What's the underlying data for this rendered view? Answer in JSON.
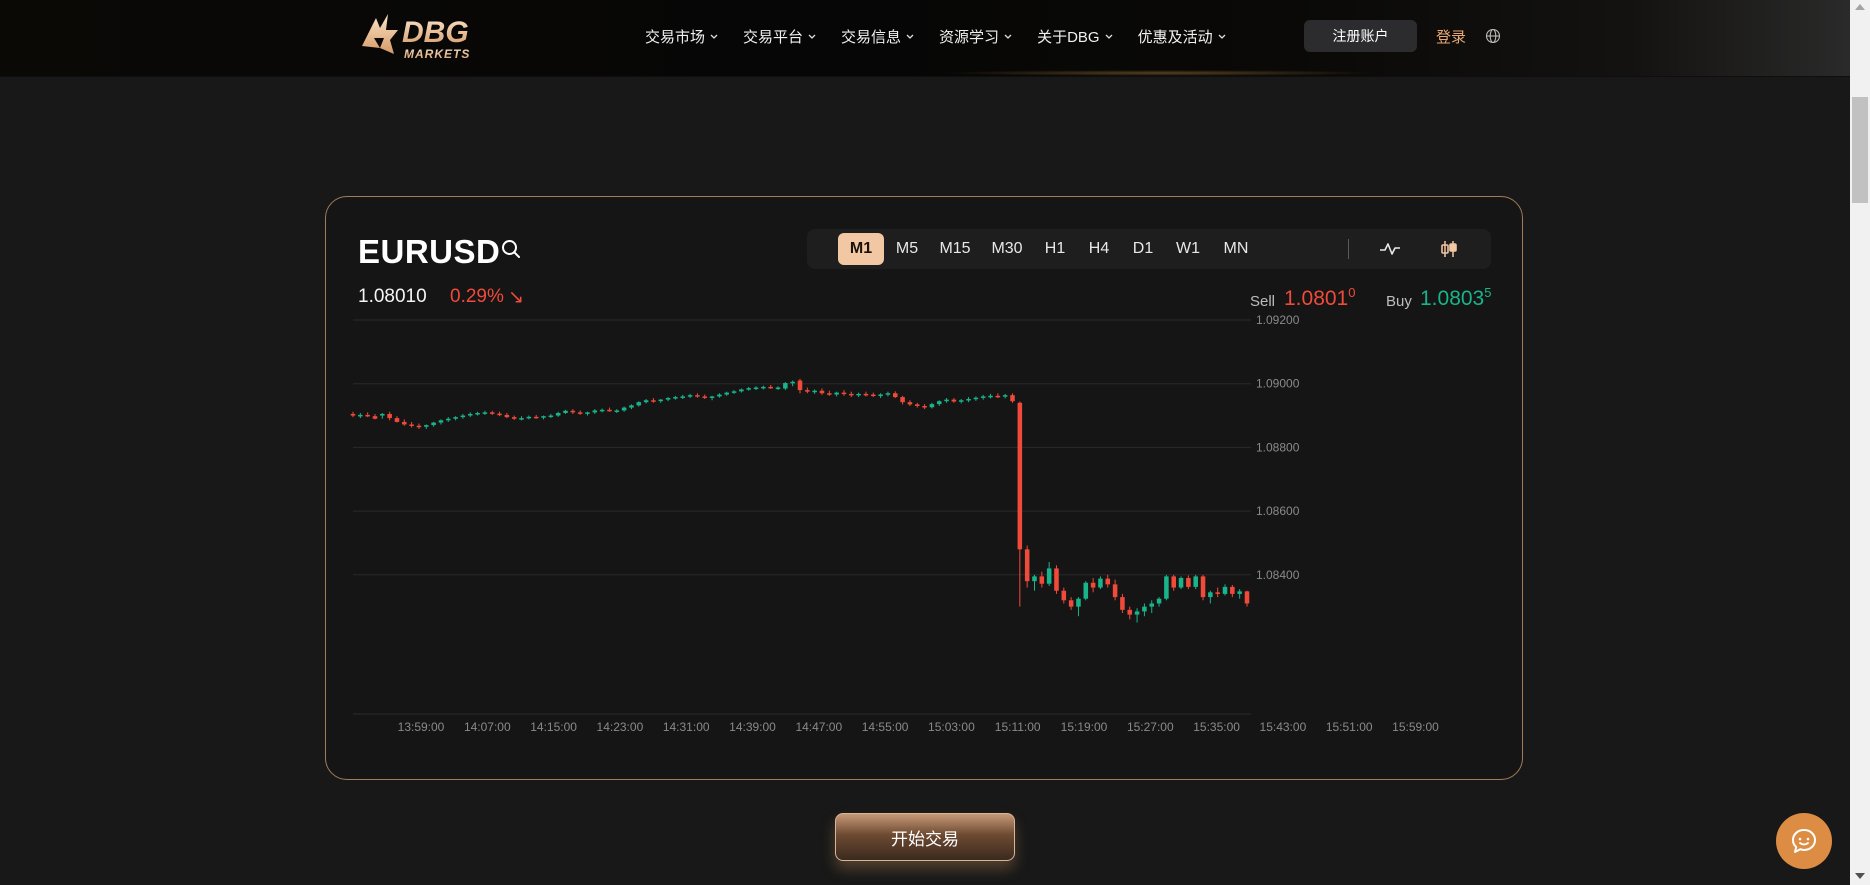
{
  "brand": {
    "name": "DBG",
    "tagline": "MARKETS"
  },
  "nav": {
    "items": [
      {
        "label": "交易市场"
      },
      {
        "label": "交易平台"
      },
      {
        "label": "交易信息"
      },
      {
        "label": "资源学习"
      },
      {
        "label": "关于DBG"
      },
      {
        "label": "优惠及活动"
      }
    ],
    "register": "注册账户",
    "login": "登录",
    "language_icon": "globe-icon"
  },
  "quote": {
    "symbol": "EURUSD",
    "price": "1.08010",
    "change": "0.29%",
    "direction": "down",
    "direction_glyph": "↘",
    "sell_label": "Sell",
    "sell_main": "1.0801",
    "sell_sup": "0",
    "buy_label": "Buy",
    "buy_main": "1.0803",
    "buy_sup": "5"
  },
  "timeframes": [
    "M1",
    "M5",
    "M15",
    "M30",
    "H1",
    "H4",
    "D1",
    "W1",
    "MN"
  ],
  "active_timeframe": "M1",
  "chart_icons": [
    "line-chart-icon",
    "candlestick-icon"
  ],
  "colors": {
    "up": "#19b48a",
    "down": "#ef4a3a",
    "accent": "#e7a873"
  },
  "chart_data": {
    "type": "candlestick",
    "y_ticks": [
      "1.09200",
      "1.09000",
      "1.08800",
      "1.08600",
      "1.08400"
    ],
    "ylim": [
      1.0824,
      1.092
    ],
    "x_ticks": [
      "13:59:00",
      "14:07:00",
      "14:15:00",
      "14:23:00",
      "14:31:00",
      "14:39:00",
      "14:47:00",
      "14:55:00",
      "15:03:00",
      "15:11:00",
      "15:19:00",
      "15:27:00",
      "15:35:00",
      "15:43:00",
      "15:51:00",
      "15:59:00"
    ],
    "grid": true,
    "candles": [
      [
        1.08905,
        1.08912,
        1.08895,
        1.089
      ],
      [
        1.089,
        1.08908,
        1.08892,
        1.08902
      ],
      [
        1.08902,
        1.0891,
        1.08895,
        1.08898
      ],
      [
        1.08898,
        1.08905,
        1.08888,
        1.0889
      ],
      [
        1.089,
        1.08908,
        1.0889,
        1.08905
      ],
      [
        1.08905,
        1.08912,
        1.08885,
        1.08892
      ],
      [
        1.08892,
        1.08898,
        1.08878,
        1.0888
      ],
      [
        1.0888,
        1.08888,
        1.08868,
        1.08872
      ],
      [
        1.08872,
        1.0888,
        1.08862,
        1.08868
      ],
      [
        1.08868,
        1.08875,
        1.08858,
        1.08865
      ],
      [
        1.08865,
        1.08872,
        1.08858,
        1.0887
      ],
      [
        1.0887,
        1.0888,
        1.08865,
        1.08878
      ],
      [
        1.08878,
        1.08888,
        1.08872,
        1.08885
      ],
      [
        1.08885,
        1.08895,
        1.0888,
        1.0889
      ],
      [
        1.0889,
        1.08898,
        1.08885,
        1.08895
      ],
      [
        1.08895,
        1.08905,
        1.0889,
        1.089
      ],
      [
        1.089,
        1.0891,
        1.08895,
        1.08905
      ],
      [
        1.08905,
        1.08912,
        1.089,
        1.08908
      ],
      [
        1.08908,
        1.08915,
        1.08902,
        1.0891
      ],
      [
        1.0891,
        1.08915,
        1.08902,
        1.08906
      ],
      [
        1.08906,
        1.08912,
        1.08898,
        1.08902
      ],
      [
        1.08902,
        1.08908,
        1.08892,
        1.08895
      ],
      [
        1.08895,
        1.089,
        1.08886,
        1.0889
      ],
      [
        1.0889,
        1.08898,
        1.08885,
        1.08892
      ],
      [
        1.08892,
        1.089,
        1.08888,
        1.08896
      ],
      [
        1.08896,
        1.08902,
        1.0889,
        1.08894
      ],
      [
        1.08894,
        1.089,
        1.08888,
        1.08898
      ],
      [
        1.08898,
        1.08905,
        1.08892,
        1.089
      ],
      [
        1.089,
        1.08912,
        1.08896,
        1.08908
      ],
      [
        1.08908,
        1.08918,
        1.08905,
        1.08915
      ],
      [
        1.08915,
        1.0892,
        1.08905,
        1.0891
      ],
      [
        1.0891,
        1.08916,
        1.08902,
        1.08906
      ],
      [
        1.08906,
        1.08912,
        1.089,
        1.0891
      ],
      [
        1.0891,
        1.0892,
        1.08905,
        1.08916
      ],
      [
        1.08916,
        1.08922,
        1.0891,
        1.08918
      ],
      [
        1.08918,
        1.08925,
        1.08912,
        1.08914
      ],
      [
        1.08914,
        1.0892,
        1.08908,
        1.08916
      ],
      [
        1.08916,
        1.08928,
        1.08912,
        1.08925
      ],
      [
        1.08925,
        1.08935,
        1.0892,
        1.08932
      ],
      [
        1.08932,
        1.08945,
        1.08928,
        1.08942
      ],
      [
        1.08942,
        1.08952,
        1.08938,
        1.08948
      ],
      [
        1.08948,
        1.08955,
        1.0894,
        1.08946
      ],
      [
        1.08946,
        1.08952,
        1.0894,
        1.0895
      ],
      [
        1.0895,
        1.08958,
        1.08945,
        1.08955
      ],
      [
        1.08955,
        1.08962,
        1.0895,
        1.08958
      ],
      [
        1.08958,
        1.08965,
        1.08952,
        1.0896
      ],
      [
        1.0896,
        1.08968,
        1.08955,
        1.08964
      ],
      [
        1.08964,
        1.0897,
        1.08956,
        1.0896
      ],
      [
        1.0896,
        1.08966,
        1.08952,
        1.08956
      ],
      [
        1.08956,
        1.08962,
        1.08948,
        1.0896
      ],
      [
        1.0896,
        1.0897,
        1.08956,
        1.08966
      ],
      [
        1.08966,
        1.08975,
        1.08962,
        1.08972
      ],
      [
        1.08972,
        1.0898,
        1.08968,
        1.08976
      ],
      [
        1.08976,
        1.08985,
        1.08972,
        1.08982
      ],
      [
        1.08982,
        1.0899,
        1.08978,
        1.08986
      ],
      [
        1.08986,
        1.08992,
        1.0898,
        1.08988
      ],
      [
        1.08988,
        1.08994,
        1.08982,
        1.0899
      ],
      [
        1.0899,
        1.08996,
        1.08984,
        1.08986
      ],
      [
        1.08986,
        1.08992,
        1.0898,
        1.08988
      ],
      [
        1.08985,
        1.09005,
        1.0898,
        1.09002
      ],
      [
        1.09002,
        1.0901,
        1.08992,
        1.09006
      ],
      [
        1.0901,
        1.09015,
        1.0897,
        1.0898
      ],
      [
        1.0898,
        1.08988,
        1.0897,
        1.08975
      ],
      [
        1.08975,
        1.08982,
        1.08968,
        1.08978
      ],
      [
        1.08978,
        1.08985,
        1.08965,
        1.0897
      ],
      [
        1.0897,
        1.08978,
        1.08962,
        1.08966
      ],
      [
        1.08966,
        1.08975,
        1.0896,
        1.08972
      ],
      [
        1.08972,
        1.0898,
        1.08962,
        1.08968
      ],
      [
        1.08968,
        1.08975,
        1.08958,
        1.08965
      ],
      [
        1.08965,
        1.08972,
        1.08958,
        1.08968
      ],
      [
        1.08968,
        1.08975,
        1.0896,
        1.08966
      ],
      [
        1.08966,
        1.08972,
        1.08958,
        1.08962
      ],
      [
        1.08962,
        1.0897,
        1.08955,
        1.08966
      ],
      [
        1.08966,
        1.08975,
        1.0896,
        1.0897
      ],
      [
        1.0897,
        1.08976,
        1.08955,
        1.08958
      ],
      [
        1.08958,
        1.08962,
        1.08935,
        1.08942
      ],
      [
        1.08942,
        1.08948,
        1.0893,
        1.08935
      ],
      [
        1.08935,
        1.0894,
        1.08925,
        1.0893
      ],
      [
        1.0893,
        1.08936,
        1.0892,
        1.08926
      ],
      [
        1.08926,
        1.0894,
        1.08922,
        1.08936
      ],
      [
        1.08936,
        1.08948,
        1.0893,
        1.08945
      ],
      [
        1.08945,
        1.08955,
        1.0894,
        1.0895
      ],
      [
        1.0895,
        1.08955,
        1.0894,
        1.08944
      ],
      [
        1.08944,
        1.08952,
        1.08938,
        1.08948
      ],
      [
        1.08948,
        1.08958,
        1.08942,
        1.08952
      ],
      [
        1.08952,
        1.0896,
        1.08946,
        1.08956
      ],
      [
        1.08956,
        1.08965,
        1.0895,
        1.0896
      ],
      [
        1.0896,
        1.08968,
        1.08954,
        1.08962
      ],
      [
        1.08962,
        1.0897,
        1.08955,
        1.0896
      ],
      [
        1.0896,
        1.08968,
        1.08954,
        1.08964
      ],
      [
        1.08964,
        1.0897,
        1.0894,
        1.08945
      ],
      [
        1.0894,
        1.08944,
        1.083,
        1.0848
      ],
      [
        1.0848,
        1.08492,
        1.0836,
        1.0838
      ],
      [
        1.0838,
        1.084,
        1.0835,
        1.08395
      ],
      [
        1.08395,
        1.0841,
        1.0836,
        1.08372
      ],
      [
        1.08372,
        1.0844,
        1.08365,
        1.0842
      ],
      [
        1.0842,
        1.0843,
        1.0834,
        1.0835
      ],
      [
        1.0835,
        1.0836,
        1.0831,
        1.0832
      ],
      [
        1.0832,
        1.0833,
        1.0829,
        1.083
      ],
      [
        1.083,
        1.0833,
        1.0827,
        1.08325
      ],
      [
        1.08325,
        1.0838,
        1.0832,
        1.08375
      ],
      [
        1.08375,
        1.0839,
        1.08345,
        1.0836
      ],
      [
        1.0836,
        1.08395,
        1.08355,
        1.08388
      ],
      [
        1.08388,
        1.084,
        1.0836,
        1.0837
      ],
      [
        1.0837,
        1.08385,
        1.0832,
        1.0833
      ],
      [
        1.0833,
        1.0834,
        1.0828,
        1.0829
      ],
      [
        1.0829,
        1.083,
        1.0826,
        1.08275
      ],
      [
        1.08275,
        1.08295,
        1.0825,
        1.08285
      ],
      [
        1.08285,
        1.0831,
        1.0827,
        1.083
      ],
      [
        1.083,
        1.0832,
        1.0828,
        1.0831
      ],
      [
        1.0831,
        1.0833,
        1.083,
        1.08325
      ],
      [
        1.08325,
        1.084,
        1.0832,
        1.08395
      ],
      [
        1.08395,
        1.084,
        1.0835,
        1.0836
      ],
      [
        1.0836,
        1.08395,
        1.08355,
        1.0839
      ],
      [
        1.0839,
        1.08398,
        1.08355,
        1.08362
      ],
      [
        1.08362,
        1.084,
        1.08355,
        1.08395
      ],
      [
        1.08395,
        1.084,
        1.0832,
        1.0833
      ],
      [
        1.0833,
        1.0835,
        1.0831,
        1.08345
      ],
      [
        1.08345,
        1.0836,
        1.0833,
        1.0834
      ],
      [
        1.0834,
        1.0837,
        1.08335,
        1.08362
      ],
      [
        1.08362,
        1.08368,
        1.0833,
        1.0834
      ],
      [
        1.0834,
        1.08355,
        1.08325,
        1.08348
      ],
      [
        1.08348,
        1.0835,
        1.083,
        1.0831
      ]
    ]
  },
  "cta": {
    "start_trading": "开始交易"
  },
  "chat_icon": "chat-bubble-icon"
}
